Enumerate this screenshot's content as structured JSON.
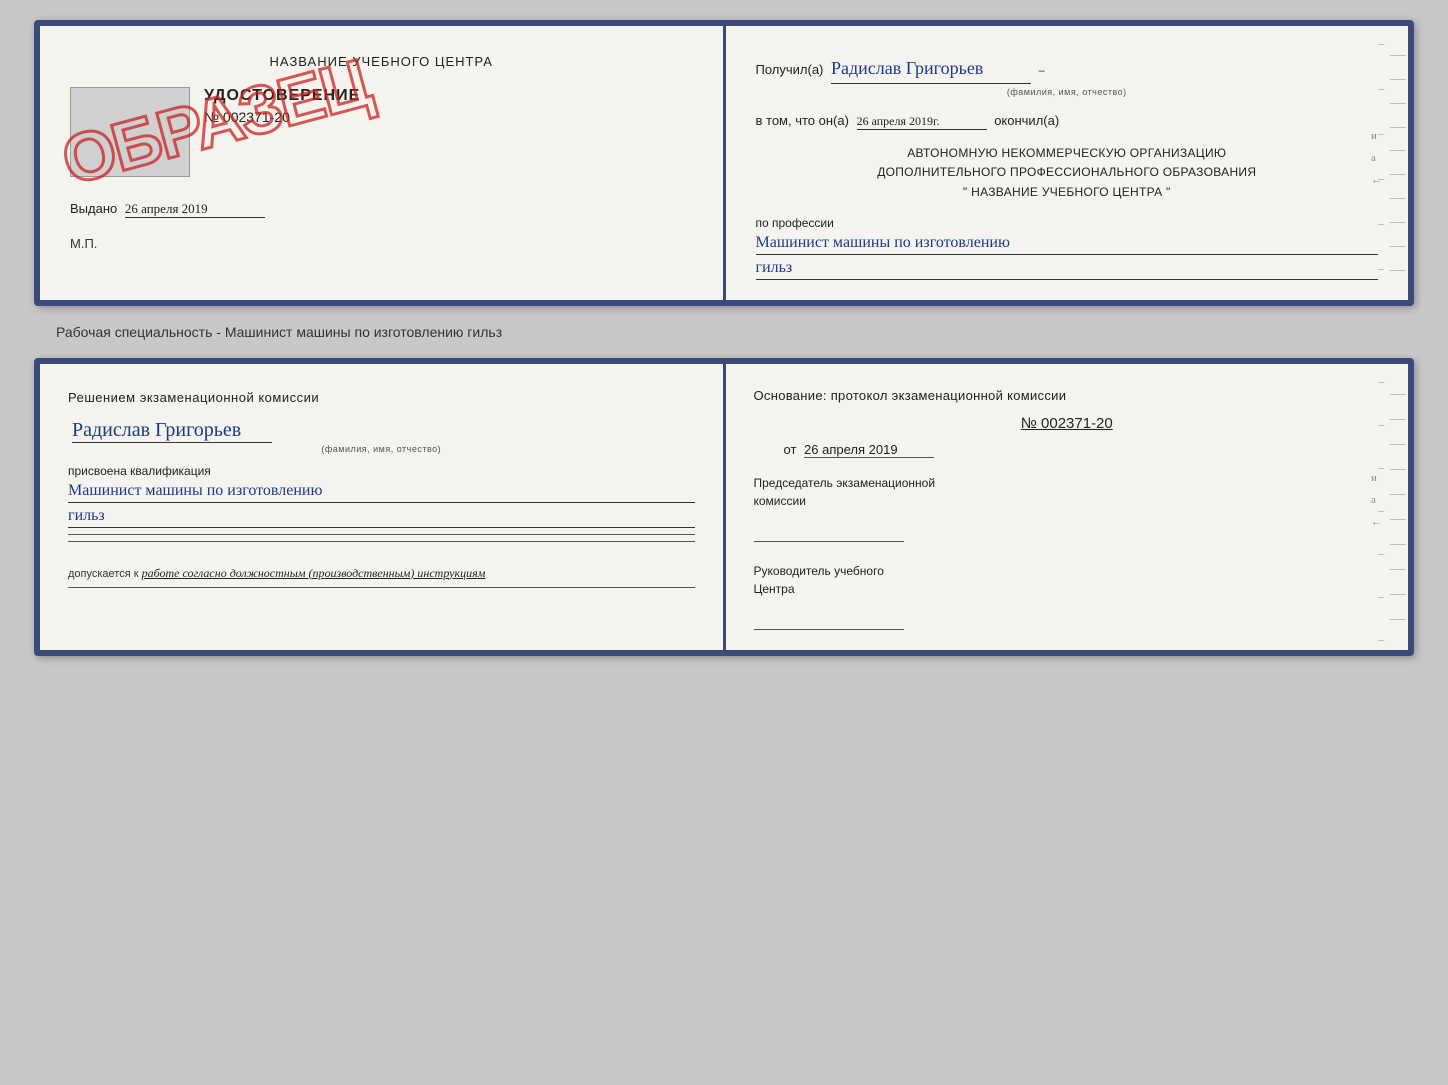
{
  "top_card": {
    "left": {
      "org_name": "НАЗВАНИЕ УЧЕБНОГО ЦЕНТРА",
      "cert_title": "УДОСТОВЕРЕНИЕ",
      "cert_number": "№ 002371-20",
      "issued_label": "Выдано",
      "issued_date": "26 апреля 2019",
      "mp_label": "М.П.",
      "stamp_text": "ОБРАЗЕЦ"
    },
    "right": {
      "received_prefix": "Получил(а)",
      "recipient_name": "Радислав Григорьев",
      "fio_label": "(фамилия, имя, отчество)",
      "date_prefix": "в том, что он(а)",
      "date_value": "26 апреля 2019г.",
      "date_suffix": "окончил(а)",
      "org_line1": "АВТОНОМНУЮ НЕКОММЕРЧЕСКУЮ ОРГАНИЗАЦИЮ",
      "org_line2": "ДОПОЛНИТЕЛЬНОГО ПРОФЕССИОНАЛЬНОГО ОБРАЗОВАНИЯ",
      "org_line3": "\"   НАЗВАНИЕ УЧЕБНОГО ЦЕНТРА   \"",
      "profession_label": "по профессии",
      "profession_value": "Машинист машины по изготовлению",
      "profession_value2": "гильз"
    }
  },
  "between_label": "Рабочая специальность - Машинист машины по изготовлению гильз",
  "bottom_card": {
    "left": {
      "section_title": "Решением  экзаменационной  комиссии",
      "recipient_name": "Радислав Григорьев",
      "fio_label": "(фамилия, имя, отчество)",
      "qualification_label": "присвоена квалификация",
      "qualification_value": "Машинист машины по изготовлению",
      "qualification_value2": "гильз",
      "allowed_prefix": "допускается к",
      "allowed_text": "работе согласно должностным (производственным) инструкциям"
    },
    "right": {
      "basis_title": "Основание: протокол экзаменационной  комиссии",
      "protocol_number": "№  002371-20",
      "date_prefix": "от",
      "date_value": "26 апреля 2019",
      "chairman_label1": "Председатель экзаменационной",
      "chairman_label2": "комиссии",
      "director_label1": "Руководитель учебного",
      "director_label2": "Центра"
    }
  }
}
